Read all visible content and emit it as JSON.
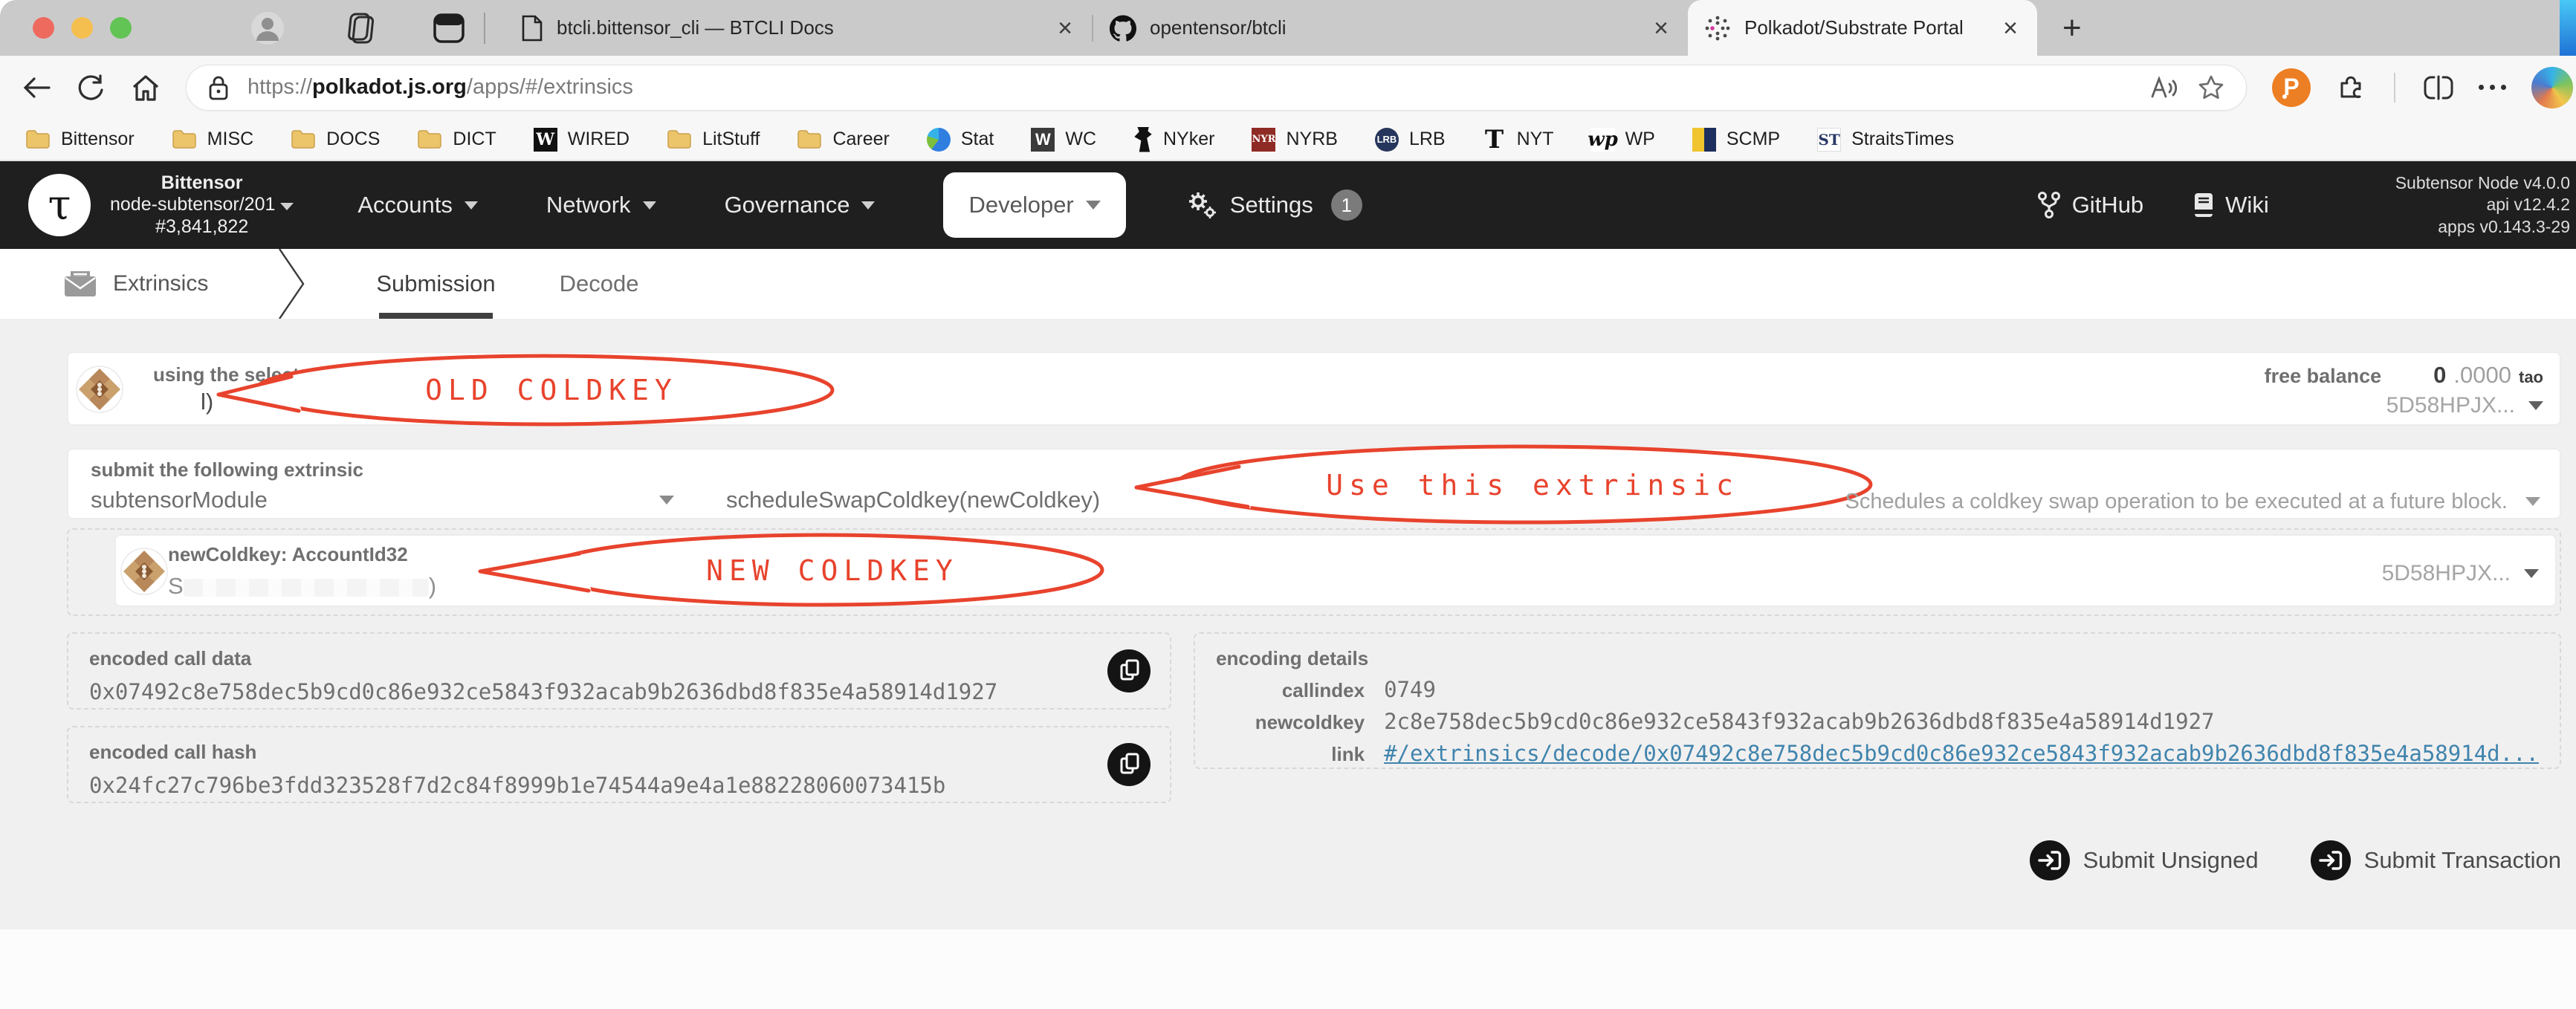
{
  "colors": {
    "accent_red": "#e8432d",
    "link_blue": "#4084ad",
    "header_bg": "#1f1f1f"
  },
  "browser": {
    "new_tab": "+",
    "close_glyph": "×",
    "extension_glyph": "P",
    "tabs": [
      {
        "title": "btcli.bittensor_cli — BTCLI Docs"
      },
      {
        "title": "opentensor/btcli"
      },
      {
        "title": "Polkadot/Substrate Portal"
      }
    ],
    "url": {
      "scheme": "https://",
      "host": "polkadot.js.org",
      "path": "/apps/#/extrinsics"
    },
    "bookmarks": [
      {
        "label": "Bittensor"
      },
      {
        "label": "MISC"
      },
      {
        "label": "DOCS"
      },
      {
        "label": "DICT"
      },
      {
        "label": "WIRED",
        "glyph": "W"
      },
      {
        "label": "LitStuff"
      },
      {
        "label": "Career"
      },
      {
        "label": "Stat"
      },
      {
        "label": "WC",
        "glyph": "W"
      },
      {
        "label": "NYker"
      },
      {
        "label": "NYRB",
        "glyph": "NYR"
      },
      {
        "label": "LRB",
        "glyph": "LRB"
      },
      {
        "label": "NYT",
        "glyph": "T"
      },
      {
        "label": "WP",
        "glyph": "wp"
      },
      {
        "label": "SCMP"
      },
      {
        "label": "StraitsTimes",
        "glyph": "ST"
      }
    ]
  },
  "header": {
    "logo_glyph": "τ",
    "chain": "Bittensor",
    "node": "node-subtensor/201",
    "block": "#3,841,822",
    "menus": [
      {
        "label": "Accounts"
      },
      {
        "label": "Network"
      },
      {
        "label": "Governance"
      },
      {
        "label": "Developer",
        "active": true
      }
    ],
    "settings": {
      "label": "Settings",
      "badge": "1"
    },
    "links": [
      {
        "label": "GitHub"
      },
      {
        "label": "Wiki"
      }
    ],
    "versions": [
      "Subtensor Node v4.0.0",
      "api v12.4.2",
      "apps v0.143.3-29"
    ]
  },
  "subnav": {
    "section": "Extrinsics",
    "tabs": [
      {
        "label": "Submission",
        "active": true
      },
      {
        "label": "Decode"
      }
    ]
  },
  "account_row": {
    "label": "using the selected account",
    "redacted_visible": "l)",
    "annotation": "OLD COLDKEY",
    "free_balance_label": "free balance",
    "balance_int": "0",
    "balance_frac": ".0000",
    "balance_unit": "tao",
    "address_short": "5D58HPJX..."
  },
  "extrinsic_row": {
    "label": "submit the following extrinsic",
    "module": "subtensorModule",
    "method": "scheduleSwapColdkey(newColdkey)",
    "annotation": "Use this extrinsic",
    "description": "Schedules a coldkey swap operation to be executed at a future block."
  },
  "param_row": {
    "label": "newColdkey: AccountId32",
    "redacted_prefix": "S",
    "redacted_suffix": ")",
    "annotation": "NEW COLDKEY",
    "address_short": "5D58HPJX..."
  },
  "encoded_call_data": {
    "label": "encoded call data",
    "value": "0x07492c8e758dec5b9cd0c86e932ce5843f932acab9b2636dbd8f835e4a58914d1927"
  },
  "encoded_call_hash": {
    "label": "encoded call hash",
    "value": "0x24fc27c796be3fdd323528f7d2c84f8999b1e74544a9e4a1e88228060073415b"
  },
  "encoding_details": {
    "title": "encoding details",
    "rows": [
      {
        "key": "callindex",
        "value": "0749"
      },
      {
        "key": "newcoldkey",
        "value": "2c8e758dec5b9cd0c86e932ce5843f932acab9b2636dbd8f835e4a58914d1927"
      },
      {
        "key": "link",
        "value": "#/extrinsics/decode/0x07492c8e758dec5b9cd0c86e932ce5843f932acab9b2636dbd8f835e4a58914d...",
        "is_link": true
      }
    ]
  },
  "actions": [
    {
      "label": "Submit Unsigned"
    },
    {
      "label": "Submit Transaction"
    }
  ]
}
